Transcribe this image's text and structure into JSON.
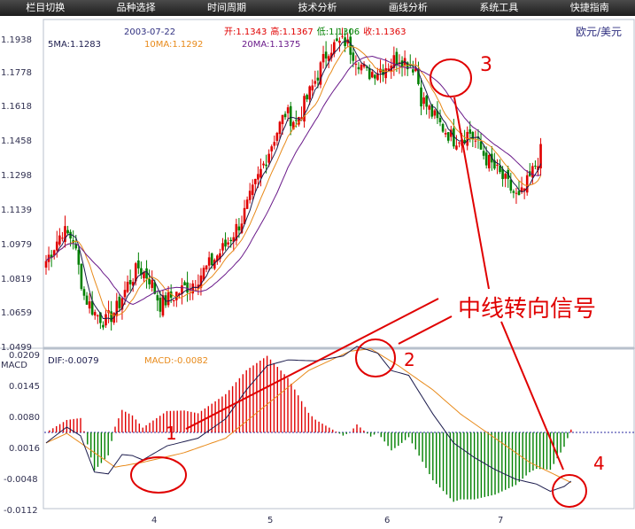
{
  "menu": [
    "栏目切换",
    "品种选择",
    "时间周期",
    "技术分析",
    "画线分析",
    "系统工具",
    "快捷指南"
  ],
  "instrument": "欧元/美元",
  "quote": {
    "date": "2003-07-22",
    "open_label": "开:",
    "open": "1.1343",
    "high_label": "高:",
    "high": "1.1367",
    "low_label": "低:",
    "low": "1.1306",
    "close_label": "收:",
    "close": "1.1363"
  },
  "ma_legend": [
    {
      "label": "5MA:1.1283",
      "color": "#1c1c4d"
    },
    {
      "label": "10MA:1.1292",
      "color": "#e88a1a"
    },
    {
      "label": "20MA:1.1375",
      "color": "#6a1a8a"
    }
  ],
  "price_axis": [
    "1.1938",
    "1.1778",
    "1.1618",
    "1.1458",
    "1.1298",
    "1.1139",
    "1.0979",
    "1.0819",
    "1.0659",
    "1.0499"
  ],
  "macd_title": "MACD",
  "macd_legend": [
    {
      "label": "DIF:-0.0079",
      "color": "#1c1c4d"
    },
    {
      "label": "MACD:-0.0082",
      "color": "#e88a1a"
    }
  ],
  "macd_axis": [
    "0.0209",
    "0.0145",
    "0.0080",
    "0.0016",
    "-0.0048",
    "-0.0112"
  ],
  "months": [
    "4",
    "5",
    "6",
    "7"
  ],
  "annotations": {
    "title": "中线转向信号",
    "markers": [
      "1",
      "2",
      "3",
      "4"
    ],
    "color": "#e00000"
  },
  "colors": {
    "up": "#e00000",
    "down": "#008000",
    "dif": "#1c1c4d",
    "macd": "#e88a1a",
    "ma20": "#6a1a8a"
  },
  "chart_data": {
    "type": "line",
    "price_range": [
      1.0499,
      1.1938
    ],
    "macd_range": [
      -0.0112,
      0.0209
    ],
    "dif_anchors": [
      [
        0,
        0.0
      ],
      [
        6,
        0.0033
      ],
      [
        10,
        0.0015
      ],
      [
        14,
        -0.006
      ],
      [
        18,
        -0.0064
      ],
      [
        22,
        -0.0024
      ],
      [
        25,
        -0.0026
      ],
      [
        28,
        -0.0035
      ],
      [
        35,
        -0.0006
      ],
      [
        44,
        0.001
      ],
      [
        52,
        0.005
      ],
      [
        58,
        0.011
      ],
      [
        64,
        0.016
      ],
      [
        70,
        0.0172
      ],
      [
        78,
        0.017
      ],
      [
        86,
        0.018
      ],
      [
        90,
        0.02
      ],
      [
        96,
        0.0186
      ],
      [
        100,
        0.015
      ],
      [
        105,
        0.014
      ],
      [
        112,
        0.006
      ],
      [
        118,
        0.0
      ],
      [
        124,
        -0.003
      ],
      [
        130,
        -0.0055
      ],
      [
        136,
        -0.0075
      ],
      [
        142,
        -0.0085
      ],
      [
        146,
        -0.01
      ],
      [
        150,
        -0.009
      ],
      [
        152,
        -0.0079
      ]
    ],
    "macd_anchors": [
      [
        0,
        0.0
      ],
      [
        6,
        0.002
      ],
      [
        12,
        -0.001
      ],
      [
        20,
        -0.005
      ],
      [
        28,
        -0.004
      ],
      [
        40,
        -0.002
      ],
      [
        52,
        0.001
      ],
      [
        64,
        0.008
      ],
      [
        76,
        0.015
      ],
      [
        88,
        0.019
      ],
      [
        94,
        0.0195
      ],
      [
        102,
        0.016
      ],
      [
        112,
        0.011
      ],
      [
        120,
        0.006
      ],
      [
        130,
        0.001
      ],
      [
        140,
        -0.004
      ],
      [
        150,
        -0.0075
      ],
      [
        152,
        -0.0082
      ]
    ],
    "price_anchors": [
      [
        0,
        1.086
      ],
      [
        6,
        1.1
      ],
      [
        10,
        1.096
      ],
      [
        14,
        1.07
      ],
      [
        18,
        1.062
      ],
      [
        22,
        1.058
      ],
      [
        26,
        1.064
      ],
      [
        30,
        1.075
      ],
      [
        34,
        1.083
      ],
      [
        38,
        1.078
      ],
      [
        42,
        1.066
      ],
      [
        48,
        1.071
      ],
      [
        54,
        1.076
      ],
      [
        60,
        1.084
      ],
      [
        66,
        1.093
      ],
      [
        72,
        1.105
      ],
      [
        78,
        1.124
      ],
      [
        84,
        1.143
      ],
      [
        88,
        1.154
      ],
      [
        92,
        1.15
      ],
      [
        98,
        1.166
      ],
      [
        104,
        1.184
      ],
      [
        110,
        1.187
      ],
      [
        114,
        1.18
      ],
      [
        118,
        1.172
      ],
      [
        124,
        1.175
      ],
      [
        130,
        1.18
      ],
      [
        136,
        1.175
      ],
      [
        138,
        1.161
      ],
      [
        144,
        1.15
      ],
      [
        150,
        1.142
      ],
      [
        156,
        1.145
      ],
      [
        162,
        1.133
      ],
      [
        168,
        1.124
      ],
      [
        174,
        1.114
      ],
      [
        178,
        1.124
      ],
      [
        182,
        1.136
      ]
    ]
  }
}
